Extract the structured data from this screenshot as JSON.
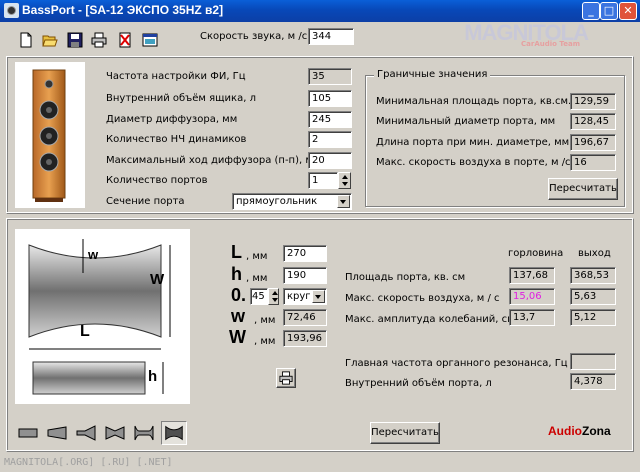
{
  "window": {
    "title": "BassPort - [SA-12 ЭКСПО 35HZ в2]",
    "min": "_",
    "max": "□",
    "close": "✕"
  },
  "watermark": {
    "brand": "MAGNITOLA",
    "sub": "CarAudio Team"
  },
  "toolbar": {
    "icons": [
      "new-icon",
      "open-icon",
      "save-icon",
      "print-icon",
      "delete-icon",
      "window-icon"
    ],
    "sound_speed_label": "Скорость звука, м /с",
    "sound_speed_value": "344"
  },
  "params": {
    "rows": [
      {
        "label": "Частота настройки ФИ, Гц",
        "value": "35"
      },
      {
        "label": "Внутренний объём ящика, л",
        "value": "105"
      },
      {
        "label": "Диаметр диффузора, мм",
        "value": "245"
      },
      {
        "label": "Количество НЧ динамиков",
        "value": "2"
      },
      {
        "label": "Максимальный ход диффузора (п-п), мм",
        "value": "20"
      },
      {
        "label": "Количество портов",
        "value": "1"
      }
    ],
    "section_label": "Сечение порта",
    "section_value": "прямоугольник"
  },
  "limits": {
    "title": "Граничные значения",
    "rows": [
      {
        "label": "Минимальная площадь порта, кв.см.",
        "value": "129,59"
      },
      {
        "label": "Минимальный диаметр порта, мм",
        "value": "128,45"
      },
      {
        "label": "Длина порта при мин. диаметре, мм",
        "value": "196,67"
      },
      {
        "label": "Макс. скорость воздуха в порте, м /с",
        "value": "16"
      }
    ],
    "recalc": "Пересчитать"
  },
  "diagram": {
    "w": "w",
    "W": "W",
    "L": "L",
    "h": "h"
  },
  "dims": {
    "L": {
      "sym": "L",
      "unit": ", мм",
      "value": "270"
    },
    "h": {
      "sym": "h",
      "unit": ", мм",
      "value": "190"
    },
    "o": {
      "sym": "0.",
      "value": "45",
      "shape": "круг"
    },
    "w": {
      "sym": "w",
      "unit": ", мм",
      "value": "72,46"
    },
    "W": {
      "sym": "W",
      "unit": ", мм",
      "value": "193,96"
    }
  },
  "results": {
    "col_throat": "горловина",
    "col_exit": "выход",
    "rows": [
      {
        "label": "Площадь порта, кв. см",
        "throat": "137,68",
        "exit": "368,53"
      },
      {
        "label": "Макс. скорость воздуха, м / с",
        "throat": "15,06",
        "exit": "5,63"
      },
      {
        "label": "Макс. амплитуда колебаний, см",
        "throat": "13,7",
        "exit": "5,12"
      }
    ],
    "organ_label": "Главная частота органного резонанса, Гц",
    "organ_value": "",
    "volume_label": "Внутренний объём порта, л",
    "volume_value": "4,378"
  },
  "bottom": {
    "recalc": "Пересчитать",
    "brand1": "Audio",
    "brand2": "Zona"
  },
  "status": "MAGNITOLA[.ORG] [.RU] [.NET]",
  "colors": {
    "titlebar": "#0a5fd8",
    "face": "#d4d0c8",
    "pink": "#e020e0",
    "brand_red": "#cc0000"
  }
}
